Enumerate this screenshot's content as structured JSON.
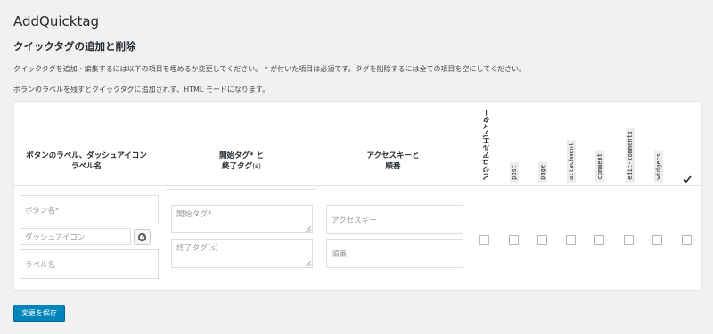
{
  "app_title": "AddQuicktag",
  "section_title": "クイックタグの追加と削除",
  "description_1": "クイックタグを追加・編集するには以下の項目を埋めるか変更してください。 * が付いた項目は必須です。タグを削除するには全ての項目を空にしてください。",
  "description_2": "ボランのラベルを残すとクイックタグに追加されず、HTML モードになります。",
  "table": {
    "headers": {
      "label_line1": "ボタンのラベル、ダッシュアイコン",
      "label_line2": "ラベル名",
      "tag_line1": "開始タグ* と",
      "tag_line2": "終了タグ",
      "tag_suffix": "(s)",
      "key_line1": "アクセスキーと",
      "key_line2": "順番",
      "visual_editor": "ビジュアルエディター",
      "post_types": [
        "post",
        "page",
        "attachment",
        "comment",
        "edit-comments",
        "widgets"
      ]
    },
    "row": {
      "button_name_placeholder": "ボタン名*",
      "dashicon_placeholder": "ダッシュアイコン",
      "label_name_placeholder": "ラベル名",
      "start_tag_placeholder": "開始タグ*",
      "end_tag_placeholder": "終了タグ(s)",
      "access_key_placeholder": "アクセスキー",
      "order_placeholder": "順番"
    }
  },
  "save_button_label": "変更を保存",
  "colors": {
    "primary": "#0085ba",
    "background": "#f1f1f1"
  }
}
